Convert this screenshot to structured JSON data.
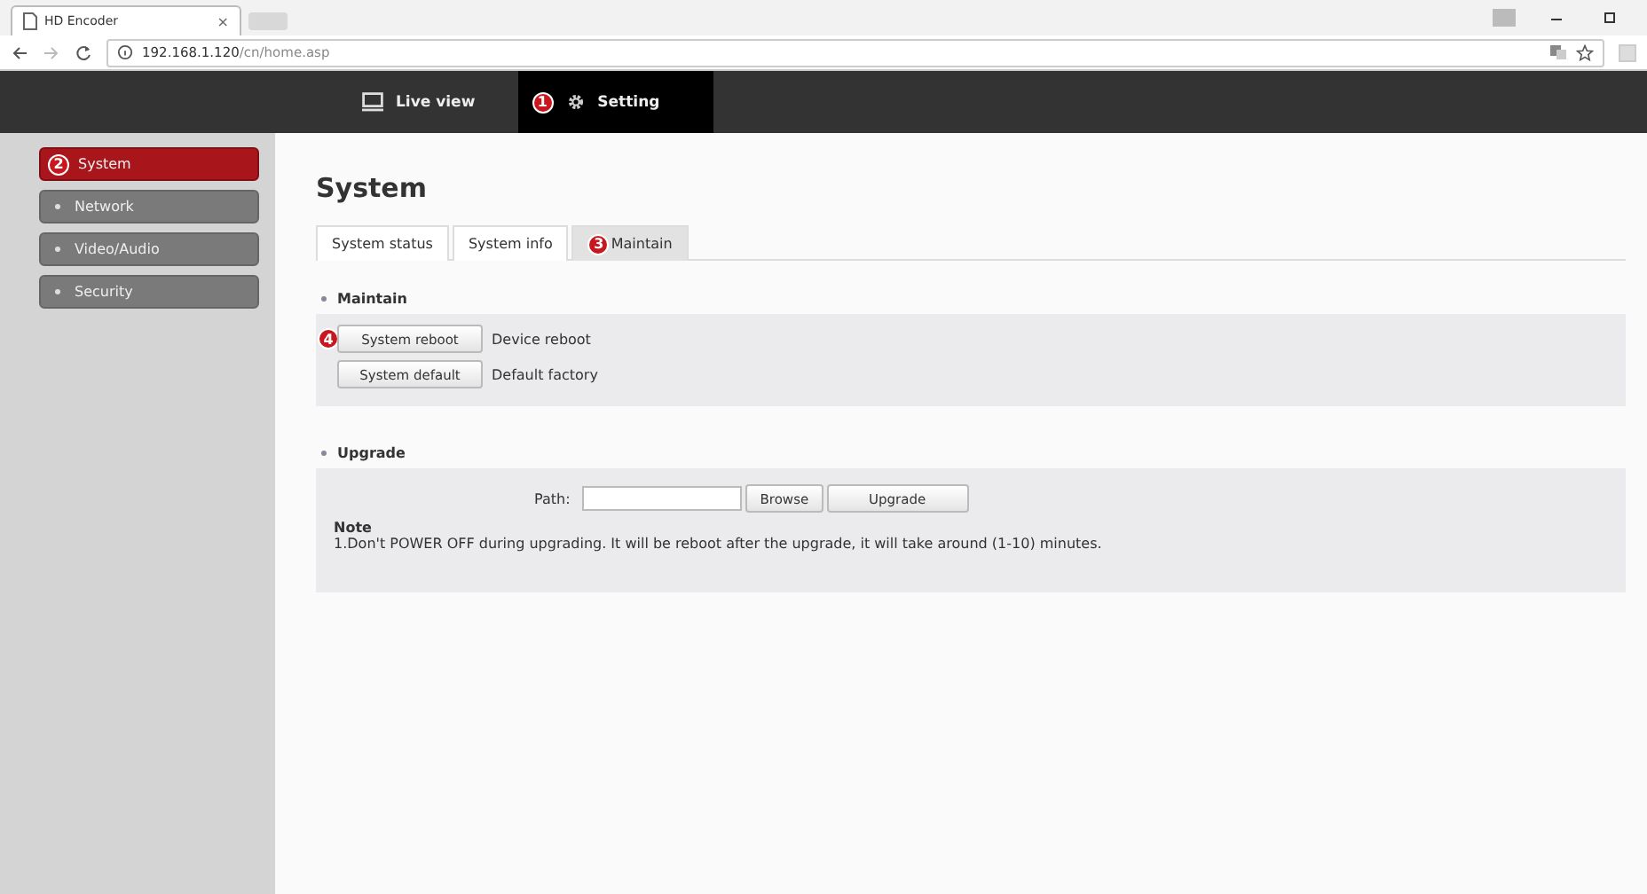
{
  "browser": {
    "tab_title": "HD Encoder",
    "tab_close": "×",
    "url_host": "192.168.1.120",
    "url_path": "/cn/home.asp"
  },
  "nav": [
    {
      "label": "Live view",
      "selected": false
    },
    {
      "label": "Setting",
      "selected": true,
      "badge": "1"
    }
  ],
  "sidebar": {
    "items": [
      {
        "label": "System",
        "selected": true,
        "badge": "2"
      },
      {
        "label": "Network",
        "selected": false
      },
      {
        "label": "Video/Audio",
        "selected": false
      },
      {
        "label": "Security",
        "selected": false
      }
    ]
  },
  "page_title": "System",
  "tabs": [
    {
      "label": "System status",
      "selected": false
    },
    {
      "label": "System info",
      "selected": false
    },
    {
      "label": "Maintain",
      "selected": true,
      "badge": "3"
    }
  ],
  "maintain": {
    "heading": "Maintain",
    "rows": [
      {
        "button": "System reboot",
        "badge": "4",
        "description": "Device reboot"
      },
      {
        "button": "System default",
        "description": "Default factory"
      }
    ]
  },
  "upgrade": {
    "heading": "Upgrade",
    "path_label": "Path:",
    "browse": "Browse",
    "upgrade_button": "Upgrade",
    "note_title": "Note",
    "note_text": "1.Don't POWER OFF during upgrading. It will be reboot after the upgrade, it will take around (1-10) minutes."
  }
}
